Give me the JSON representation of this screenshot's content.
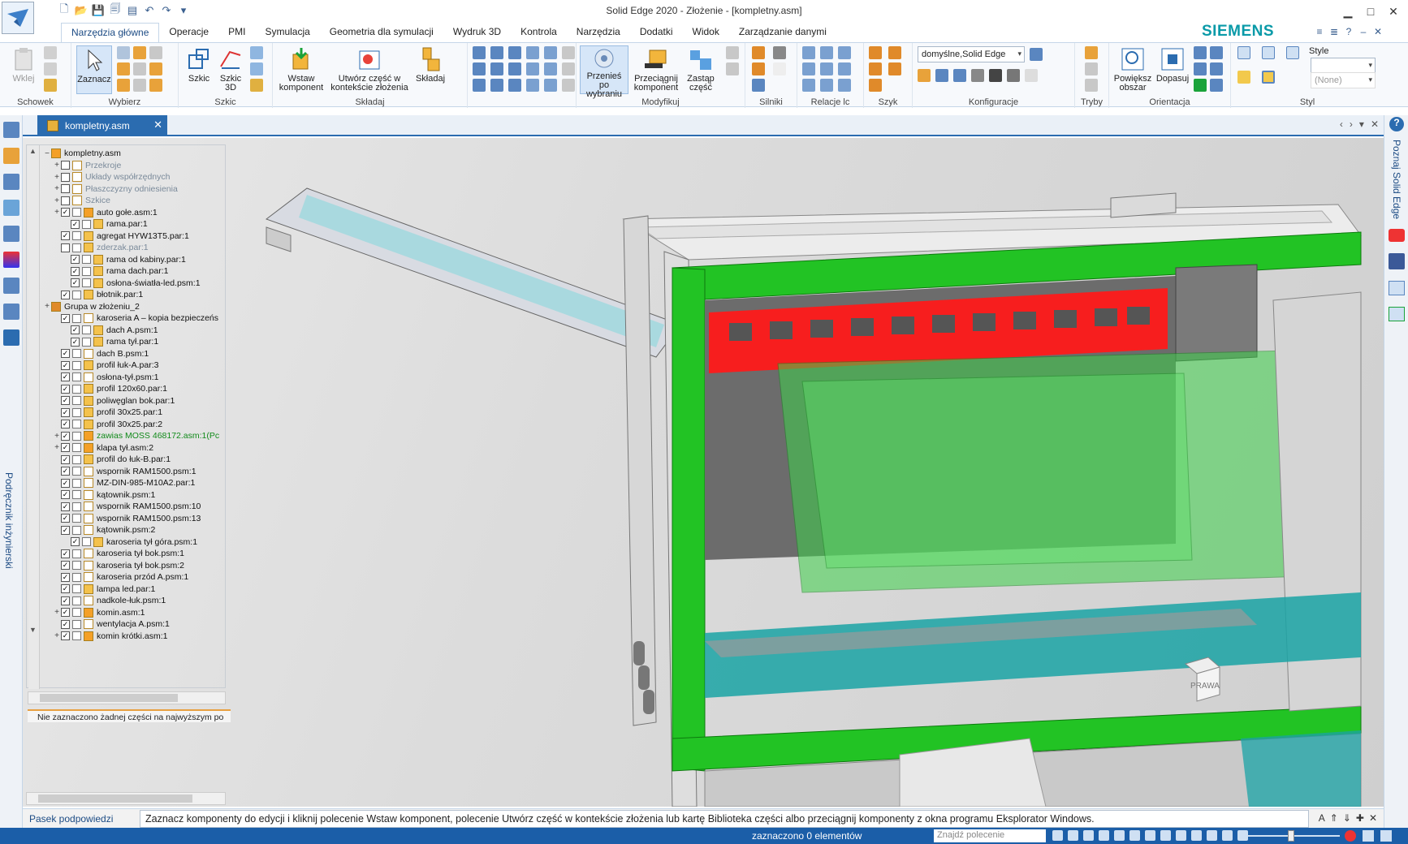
{
  "window": {
    "title": "Solid Edge 2020 - Złożenie - [kompletny.asm]",
    "controls": [
      "▁",
      "□",
      "✕"
    ]
  },
  "brand": "SIEMENS",
  "ribbon_tabs": [
    "Narzędzia główne",
    "Operacje",
    "PMI",
    "Symulacja",
    "Geometria dla symulacji",
    "Wydruk 3D",
    "Kontrola",
    "Narzędzia",
    "Dodatki",
    "Widok",
    "Zarządzanie danymi"
  ],
  "ribbon": {
    "groups": {
      "schowek": "Schowek",
      "wybierz": "Wybierz",
      "szkic": "Szkic",
      "skladaj": "Składaj",
      "modyfikuj": "Modyfikuj",
      "silniki": "Silniki",
      "relacje": "Relacje lc",
      "szyk": "Szyk",
      "konfiguracje": "Konfiguracje",
      "tryby": "Tryby",
      "orientacja": "Orientacja",
      "styl": "Styl"
    },
    "buttons": {
      "wklej": "Wklej",
      "zaznacz": "Zaznacz",
      "szkic": "Szkic",
      "szkic3d_1": "Szkic",
      "szkic3d_2": "3D",
      "wstaw_1": "Wstaw",
      "wstaw_2": "komponent",
      "utworz_1": "Utwórz część w",
      "utworz_2": "kontekście złożenia",
      "skladaj": "Składaj",
      "przenies_1": "Przenieś po",
      "przenies_2": "wybraniu",
      "przeciagnij_1": "Przeciągnij",
      "przeciagnij_2": "komponent",
      "zastap_1": "Zastąp",
      "zastap_2": "część",
      "powieksz_1": "Powiększ",
      "powieksz_2": "obszar",
      "dopasuj": "Dopasuj"
    },
    "config_value": "domyślne,Solid Edge",
    "style_label": "Style",
    "style_value": "(None)"
  },
  "document_tab": "kompletny.asm",
  "left_vertical_text": "Podręcznik inżynierski",
  "right_vertical_text": "Poznaj Solid Edge",
  "tree": [
    {
      "label": "kompletny.asm",
      "indent": 0,
      "toggle": "−",
      "checked": null,
      "lock": false,
      "icon": "asm",
      "style": ""
    },
    {
      "label": "Przekroje",
      "indent": 1,
      "toggle": "+",
      "checked": false,
      "lock": false,
      "icon": "sm",
      "style": "grey"
    },
    {
      "label": "Układy współrzędnych",
      "indent": 1,
      "toggle": "+",
      "checked": false,
      "lock": false,
      "icon": "sm",
      "style": "grey"
    },
    {
      "label": "Płaszczyzny odniesienia",
      "indent": 1,
      "toggle": "+",
      "checked": false,
      "lock": false,
      "icon": "sm",
      "style": "grey"
    },
    {
      "label": "Szkice",
      "indent": 1,
      "toggle": "+",
      "checked": false,
      "lock": false,
      "icon": "sm",
      "style": "grey"
    },
    {
      "label": "auto gołe.asm:1",
      "indent": 1,
      "toggle": "+",
      "checked": true,
      "lock": true,
      "icon": "asm",
      "style": ""
    },
    {
      "label": "rama.par:1",
      "indent": 2,
      "toggle": "",
      "checked": true,
      "lock": true,
      "icon": "par",
      "style": ""
    },
    {
      "label": "agregat HYW13T5.par:1",
      "indent": 1,
      "toggle": "",
      "checked": true,
      "lock": true,
      "icon": "par",
      "style": ""
    },
    {
      "label": "zderzak.par:1",
      "indent": 1,
      "toggle": "",
      "checked": false,
      "lock": true,
      "icon": "par",
      "style": "grey"
    },
    {
      "label": "rama od kabiny.par:1",
      "indent": 2,
      "toggle": "",
      "checked": true,
      "lock": true,
      "icon": "par",
      "style": ""
    },
    {
      "label": "rama dach.par:1",
      "indent": 2,
      "toggle": "",
      "checked": true,
      "lock": true,
      "icon": "par",
      "style": ""
    },
    {
      "label": "osłona-światła-led.psm:1",
      "indent": 2,
      "toggle": "",
      "checked": true,
      "lock": true,
      "icon": "par",
      "style": ""
    },
    {
      "label": "błotnik.par:1",
      "indent": 1,
      "toggle": "",
      "checked": true,
      "lock": true,
      "icon": "par",
      "style": ""
    },
    {
      "label": "Grupa w złożeniu_2",
      "indent": 0,
      "toggle": "+",
      "checked": null,
      "lock": false,
      "icon": "grp",
      "style": ""
    },
    {
      "label": "karoseria A – kopia bezpieczeńs",
      "indent": 1,
      "toggle": "",
      "checked": true,
      "lock": true,
      "icon": "sm",
      "style": ""
    },
    {
      "label": "dach A.psm:1",
      "indent": 2,
      "toggle": "",
      "checked": true,
      "lock": true,
      "icon": "par",
      "style": ""
    },
    {
      "label": "rama tył.par:1",
      "indent": 2,
      "toggle": "",
      "checked": true,
      "lock": true,
      "icon": "par",
      "style": ""
    },
    {
      "label": "dach B.psm:1",
      "indent": 1,
      "toggle": "",
      "checked": true,
      "lock": true,
      "icon": "sm",
      "style": ""
    },
    {
      "label": "profil łuk-A.par:3",
      "indent": 1,
      "toggle": "",
      "checked": true,
      "lock": true,
      "icon": "par",
      "style": ""
    },
    {
      "label": "osłona-tył.psm:1",
      "indent": 1,
      "toggle": "",
      "checked": true,
      "lock": true,
      "icon": "sm",
      "style": ""
    },
    {
      "label": "profil 120x60.par:1",
      "indent": 1,
      "toggle": "",
      "checked": true,
      "lock": true,
      "icon": "par",
      "style": ""
    },
    {
      "label": "poliwęglan bok.par:1",
      "indent": 1,
      "toggle": "",
      "checked": true,
      "lock": true,
      "icon": "par",
      "style": ""
    },
    {
      "label": "profil 30x25.par:1",
      "indent": 1,
      "toggle": "",
      "checked": true,
      "lock": true,
      "icon": "par",
      "style": ""
    },
    {
      "label": "profil 30x25.par:2",
      "indent": 1,
      "toggle": "",
      "checked": true,
      "lock": true,
      "icon": "par",
      "style": ""
    },
    {
      "label": "zawias MOSS 468172.asm:1(Pc",
      "indent": 1,
      "toggle": "+",
      "checked": true,
      "lock": true,
      "icon": "asm",
      "style": "green"
    },
    {
      "label": "klapa tył.asm:2",
      "indent": 1,
      "toggle": "+",
      "checked": true,
      "lock": true,
      "icon": "asm",
      "style": ""
    },
    {
      "label": "profil do łuk-B.par:1",
      "indent": 1,
      "toggle": "",
      "checked": true,
      "lock": true,
      "icon": "par",
      "style": ""
    },
    {
      "label": "wspornik RAM1500.psm:1",
      "indent": 1,
      "toggle": "",
      "checked": true,
      "lock": true,
      "icon": "sm",
      "style": ""
    },
    {
      "label": "MZ-DIN-985-M10A2.par:1",
      "indent": 1,
      "toggle": "",
      "checked": true,
      "lock": true,
      "icon": "sm",
      "style": ""
    },
    {
      "label": "kątownik.psm:1",
      "indent": 1,
      "toggle": "",
      "checked": true,
      "lock": true,
      "icon": "sm",
      "style": ""
    },
    {
      "label": "wspornik RAM1500.psm:10",
      "indent": 1,
      "toggle": "",
      "checked": true,
      "lock": true,
      "icon": "sm",
      "style": ""
    },
    {
      "label": "wspornik RAM1500.psm:13",
      "indent": 1,
      "toggle": "",
      "checked": true,
      "lock": true,
      "icon": "sm",
      "style": ""
    },
    {
      "label": "kątownik.psm:2",
      "indent": 1,
      "toggle": "",
      "checked": true,
      "lock": true,
      "icon": "sm",
      "style": ""
    },
    {
      "label": "karoseria tył góra.psm:1",
      "indent": 2,
      "toggle": "",
      "checked": true,
      "lock": true,
      "icon": "par",
      "style": ""
    },
    {
      "label": "karoseria tył bok.psm:1",
      "indent": 1,
      "toggle": "",
      "checked": true,
      "lock": true,
      "icon": "sm",
      "style": ""
    },
    {
      "label": "karoseria tył bok.psm:2",
      "indent": 1,
      "toggle": "",
      "checked": true,
      "lock": true,
      "icon": "sm",
      "style": ""
    },
    {
      "label": "karoseria przód A.psm:1",
      "indent": 1,
      "toggle": "",
      "checked": true,
      "lock": true,
      "icon": "sm",
      "style": ""
    },
    {
      "label": "lampa led.par:1",
      "indent": 1,
      "toggle": "",
      "checked": true,
      "lock": true,
      "icon": "par",
      "style": ""
    },
    {
      "label": "nadkole-łuk.psm:1",
      "indent": 1,
      "toggle": "",
      "checked": true,
      "lock": true,
      "icon": "sm",
      "style": ""
    },
    {
      "label": "komin.asm:1",
      "indent": 1,
      "toggle": "+",
      "checked": true,
      "lock": true,
      "icon": "asm",
      "style": ""
    },
    {
      "label": "wentylacja A.psm:1",
      "indent": 1,
      "toggle": "",
      "checked": true,
      "lock": true,
      "icon": "sm",
      "style": ""
    },
    {
      "label": "komin krótki.asm:1",
      "indent": 1,
      "toggle": "+",
      "checked": true,
      "lock": true,
      "icon": "asm",
      "style": ""
    }
  ],
  "pathfinder_status": "Nie zaznaczono żadnej części na najwyższym po",
  "viewcube_label": "PRAWA",
  "hint": {
    "label": "Pasek podpowiedzi",
    "text": "Zaznacz komponenty do edycji i kliknij polecenie Wstaw komponent, polecenie Utwórz część w kontekście złożenia lub kartę Biblioteka części albo przeciągnij komponenty z okna programu Eksplorator Windows."
  },
  "status": {
    "selection": "zaznaczono 0 elementów",
    "find_placeholder": "Znajdź polecenie"
  },
  "colors": {
    "accent": "#1b5ea8",
    "frame_green": "#22c324",
    "red_panel": "#ff1a1a",
    "teal": "#1aa3a5",
    "brand": "#0a9aa8"
  }
}
